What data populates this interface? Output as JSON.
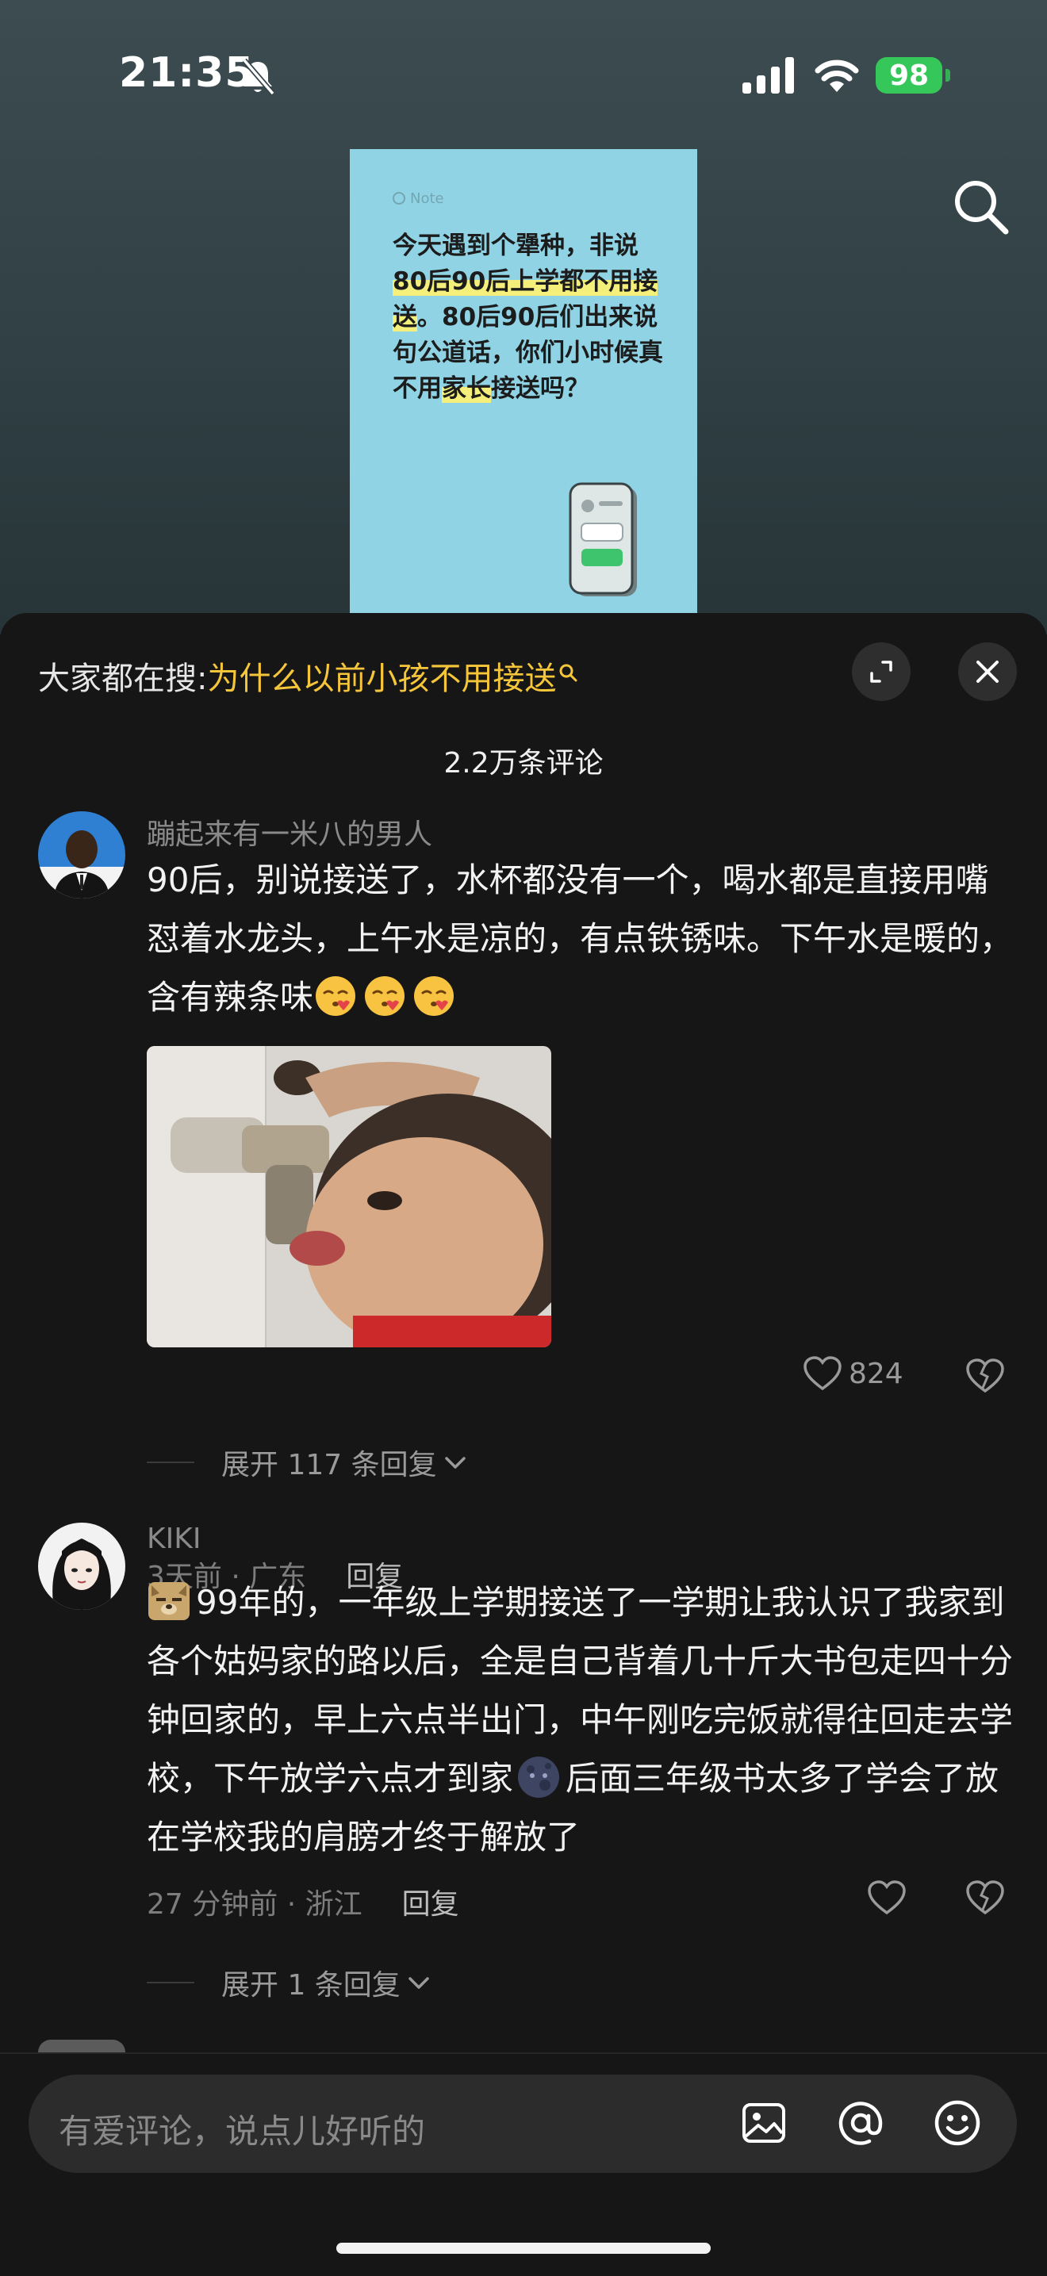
{
  "status_bar": {
    "time": "21:35",
    "battery": "98"
  },
  "note_card": {
    "label": "Note",
    "text_parts": [
      {
        "t": "今天遇到个犟种，非说",
        "hl": false
      },
      {
        "t": "80后90后上学都不用接送",
        "hl": true
      },
      {
        "t": "。80后90后们出来说句公道话，你们小时候真不用",
        "hl": false
      },
      {
        "t": "家长",
        "hl": true
      },
      {
        "t": "接送吗？",
        "hl": false
      }
    ]
  },
  "sheet": {
    "search_prefix": "大家都在搜:",
    "search_keyword": "为什么以前小孩不用接送",
    "comment_count": "2.2万条评论"
  },
  "comments": [
    {
      "author": "蹦起来有一米八的男人",
      "text": "90后，别说接送了，水杯都没有一个，喝水都是直接用嘴怼着水龙头，上午水是凉的，有点铁锈味。下午水是暖的，含有辣条味",
      "emoji_count": 3,
      "meta": "3天前 · 广东",
      "reply": "回复",
      "likes": "824",
      "expand": "展开 117 条回复"
    },
    {
      "author": "KIKI",
      "text": "99年的，一年级上学期接送了一学期让我认识了我家到各个姑妈家的路以后，全是自己背着几十斤大书包走四十分钟回家的，早上六点半出门，中午刚吃完饭就得往回走去学校，下午放学六点才到家",
      "text_after": "后面三年级书太多了学会了放在学校我的肩膀才终于解放了",
      "meta": "27 分钟前 · 浙江",
      "reply": "回复",
      "likes": "",
      "expand": "展开 1 条回复"
    }
  ],
  "input": {
    "placeholder": "有爱评论，说点儿好听的"
  },
  "colors": {
    "keyword": "#f5c53a",
    "note_bg": "#8fd3e4",
    "battery": "#35c759"
  }
}
